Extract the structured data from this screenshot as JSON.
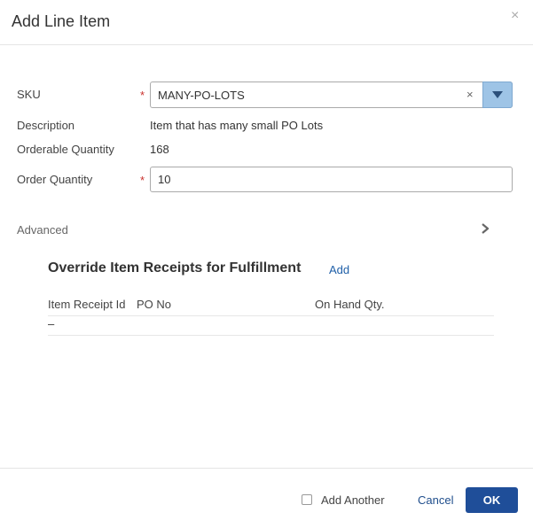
{
  "dialog": {
    "title": "Add Line Item",
    "close_glyph": "×"
  },
  "form": {
    "required_marker": "*",
    "sku": {
      "label": "SKU",
      "value": "MANY-PO-LOTS",
      "clear_glyph": "×"
    },
    "description": {
      "label": "Description",
      "value": "Item that has many small PO Lots"
    },
    "orderable_quantity": {
      "label": "Orderable Quantity",
      "value": "168"
    },
    "order_quantity": {
      "label": "Order Quantity",
      "value": "10"
    }
  },
  "advanced": {
    "label": "Advanced"
  },
  "override": {
    "title": "Override Item Receipts for Fulfillment",
    "add_label": "Add",
    "columns": [
      "Item Receipt Id",
      "PO No",
      "On Hand Qty."
    ],
    "rows": [
      [
        "–"
      ]
    ]
  },
  "footer": {
    "add_another_label": "Add Another",
    "add_another_checked": false,
    "cancel_label": "Cancel",
    "ok_label": "OK"
  },
  "colors": {
    "primary": "#1f4e99",
    "link": "#1f5fa8",
    "required": "#c9302c",
    "select_arrow": "#9ec4e6"
  }
}
